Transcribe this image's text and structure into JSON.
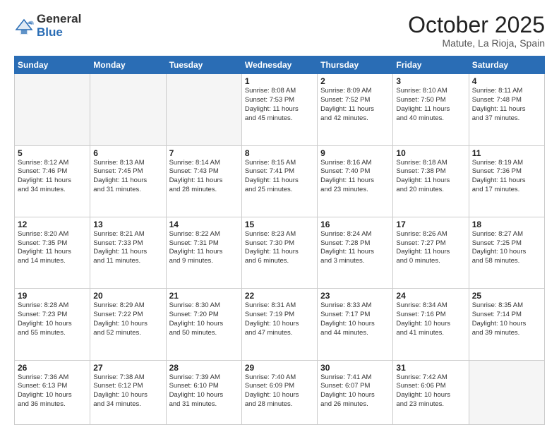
{
  "header": {
    "logo_general": "General",
    "logo_blue": "Blue",
    "month": "October 2025",
    "location": "Matute, La Rioja, Spain"
  },
  "weekdays": [
    "Sunday",
    "Monday",
    "Tuesday",
    "Wednesday",
    "Thursday",
    "Friday",
    "Saturday"
  ],
  "weeks": [
    [
      {
        "day": "",
        "info": ""
      },
      {
        "day": "",
        "info": ""
      },
      {
        "day": "",
        "info": ""
      },
      {
        "day": "1",
        "info": "Sunrise: 8:08 AM\nSunset: 7:53 PM\nDaylight: 11 hours\nand 45 minutes."
      },
      {
        "day": "2",
        "info": "Sunrise: 8:09 AM\nSunset: 7:52 PM\nDaylight: 11 hours\nand 42 minutes."
      },
      {
        "day": "3",
        "info": "Sunrise: 8:10 AM\nSunset: 7:50 PM\nDaylight: 11 hours\nand 40 minutes."
      },
      {
        "day": "4",
        "info": "Sunrise: 8:11 AM\nSunset: 7:48 PM\nDaylight: 11 hours\nand 37 minutes."
      }
    ],
    [
      {
        "day": "5",
        "info": "Sunrise: 8:12 AM\nSunset: 7:46 PM\nDaylight: 11 hours\nand 34 minutes."
      },
      {
        "day": "6",
        "info": "Sunrise: 8:13 AM\nSunset: 7:45 PM\nDaylight: 11 hours\nand 31 minutes."
      },
      {
        "day": "7",
        "info": "Sunrise: 8:14 AM\nSunset: 7:43 PM\nDaylight: 11 hours\nand 28 minutes."
      },
      {
        "day": "8",
        "info": "Sunrise: 8:15 AM\nSunset: 7:41 PM\nDaylight: 11 hours\nand 25 minutes."
      },
      {
        "day": "9",
        "info": "Sunrise: 8:16 AM\nSunset: 7:40 PM\nDaylight: 11 hours\nand 23 minutes."
      },
      {
        "day": "10",
        "info": "Sunrise: 8:18 AM\nSunset: 7:38 PM\nDaylight: 11 hours\nand 20 minutes."
      },
      {
        "day": "11",
        "info": "Sunrise: 8:19 AM\nSunset: 7:36 PM\nDaylight: 11 hours\nand 17 minutes."
      }
    ],
    [
      {
        "day": "12",
        "info": "Sunrise: 8:20 AM\nSunset: 7:35 PM\nDaylight: 11 hours\nand 14 minutes."
      },
      {
        "day": "13",
        "info": "Sunrise: 8:21 AM\nSunset: 7:33 PM\nDaylight: 11 hours\nand 11 minutes."
      },
      {
        "day": "14",
        "info": "Sunrise: 8:22 AM\nSunset: 7:31 PM\nDaylight: 11 hours\nand 9 minutes."
      },
      {
        "day": "15",
        "info": "Sunrise: 8:23 AM\nSunset: 7:30 PM\nDaylight: 11 hours\nand 6 minutes."
      },
      {
        "day": "16",
        "info": "Sunrise: 8:24 AM\nSunset: 7:28 PM\nDaylight: 11 hours\nand 3 minutes."
      },
      {
        "day": "17",
        "info": "Sunrise: 8:26 AM\nSunset: 7:27 PM\nDaylight: 11 hours\nand 0 minutes."
      },
      {
        "day": "18",
        "info": "Sunrise: 8:27 AM\nSunset: 7:25 PM\nDaylight: 10 hours\nand 58 minutes."
      }
    ],
    [
      {
        "day": "19",
        "info": "Sunrise: 8:28 AM\nSunset: 7:23 PM\nDaylight: 10 hours\nand 55 minutes."
      },
      {
        "day": "20",
        "info": "Sunrise: 8:29 AM\nSunset: 7:22 PM\nDaylight: 10 hours\nand 52 minutes."
      },
      {
        "day": "21",
        "info": "Sunrise: 8:30 AM\nSunset: 7:20 PM\nDaylight: 10 hours\nand 50 minutes."
      },
      {
        "day": "22",
        "info": "Sunrise: 8:31 AM\nSunset: 7:19 PM\nDaylight: 10 hours\nand 47 minutes."
      },
      {
        "day": "23",
        "info": "Sunrise: 8:33 AM\nSunset: 7:17 PM\nDaylight: 10 hours\nand 44 minutes."
      },
      {
        "day": "24",
        "info": "Sunrise: 8:34 AM\nSunset: 7:16 PM\nDaylight: 10 hours\nand 41 minutes."
      },
      {
        "day": "25",
        "info": "Sunrise: 8:35 AM\nSunset: 7:14 PM\nDaylight: 10 hours\nand 39 minutes."
      }
    ],
    [
      {
        "day": "26",
        "info": "Sunrise: 7:36 AM\nSunset: 6:13 PM\nDaylight: 10 hours\nand 36 minutes."
      },
      {
        "day": "27",
        "info": "Sunrise: 7:38 AM\nSunset: 6:12 PM\nDaylight: 10 hours\nand 34 minutes."
      },
      {
        "day": "28",
        "info": "Sunrise: 7:39 AM\nSunset: 6:10 PM\nDaylight: 10 hours\nand 31 minutes."
      },
      {
        "day": "29",
        "info": "Sunrise: 7:40 AM\nSunset: 6:09 PM\nDaylight: 10 hours\nand 28 minutes."
      },
      {
        "day": "30",
        "info": "Sunrise: 7:41 AM\nSunset: 6:07 PM\nDaylight: 10 hours\nand 26 minutes."
      },
      {
        "day": "31",
        "info": "Sunrise: 7:42 AM\nSunset: 6:06 PM\nDaylight: 10 hours\nand 23 minutes."
      },
      {
        "day": "",
        "info": ""
      }
    ]
  ]
}
